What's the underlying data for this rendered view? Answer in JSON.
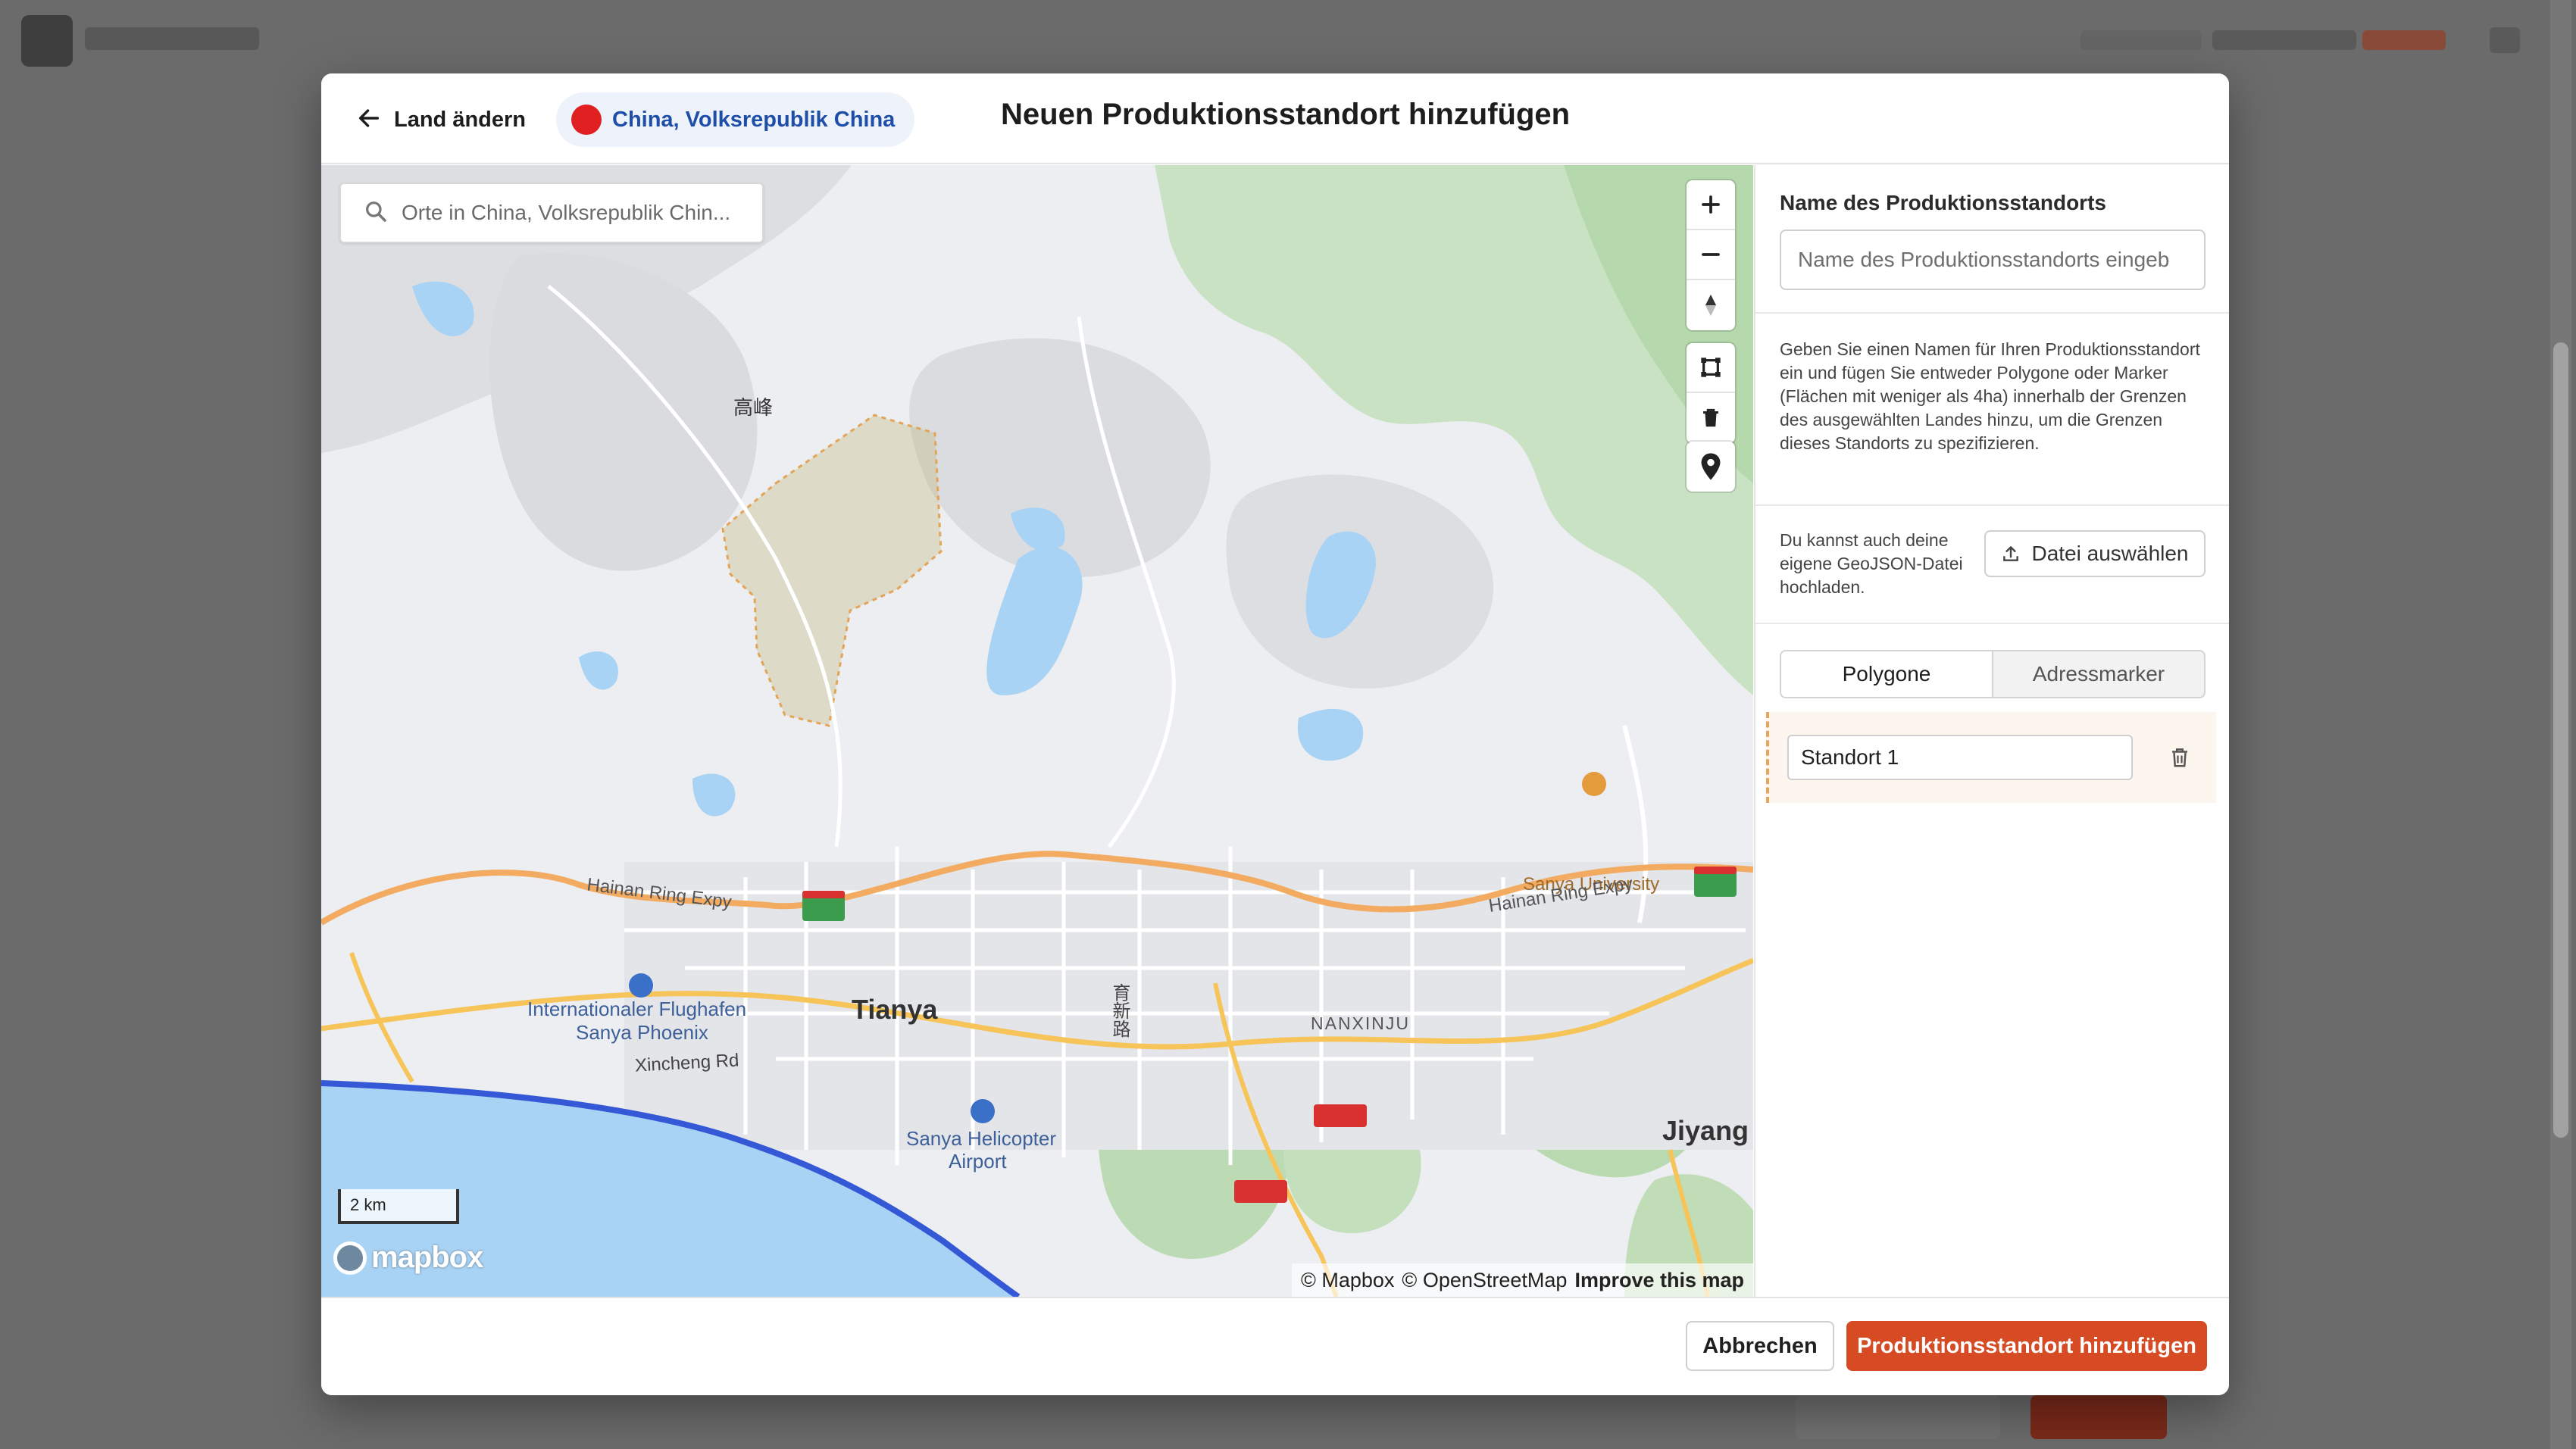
{
  "colors": {
    "accent": "#d64a24",
    "chip_bg": "#eef2fb",
    "chip_text": "#1e4ea8",
    "flag": "#e02020"
  },
  "modal": {
    "back_label": "Land ändern",
    "country_label": "China, Volksrepublik China",
    "title": "Neuen Produktionsstandort hinzufügen"
  },
  "map": {
    "search_placeholder": "Orte in China, Volksrepublik Chin...",
    "labels": {
      "gaofeng": "高峰",
      "sanya_university": "Sanya University",
      "hainan_ring_left": "Hainan Ring Expy",
      "hainan_ring_right": "Hainan Ring Expy",
      "airport": "Internationaler Flughafen",
      "airport2": "Sanya Phoenix",
      "tianya": "Tianya",
      "xincheng": "Xincheng Rd",
      "nanxinju": "NANXINJU",
      "jiyang": "Jiyang",
      "helicopter": "Sanya Helicopter",
      "helicopter2": "Airport",
      "road_vertical": "育新路"
    },
    "scale_label": "2 km",
    "logo": "mapbox",
    "attribution": {
      "mapbox": "© Mapbox",
      "osm": "© OpenStreetMap",
      "improve": "Improve this map"
    }
  },
  "sidebar": {
    "name_label": "Name des Produktionsstandorts",
    "name_placeholder": "Name des Produktionsstandorts eingeb",
    "info_text": "Geben Sie einen Namen für Ihren Produktionsstandort ein und fügen Sie entweder Polygone oder Marker (Flächen mit weniger als 4ha) innerhalb der Grenzen des ausgewählten Landes hinzu, um die Grenzen dieses Standorts zu spezifizieren.",
    "geojson_text": "Du kannst auch deine eigene GeoJSON-Datei hochladen.",
    "file_button": "Datei auswählen",
    "tabs": [
      {
        "label": "Polygone",
        "active": true
      },
      {
        "label": "Adressmarker",
        "active": false
      }
    ],
    "sites": [
      {
        "name": "Standort 1"
      }
    ]
  },
  "footer": {
    "cancel": "Abbrechen",
    "submit": "Produktionsstandort hinzufügen"
  }
}
